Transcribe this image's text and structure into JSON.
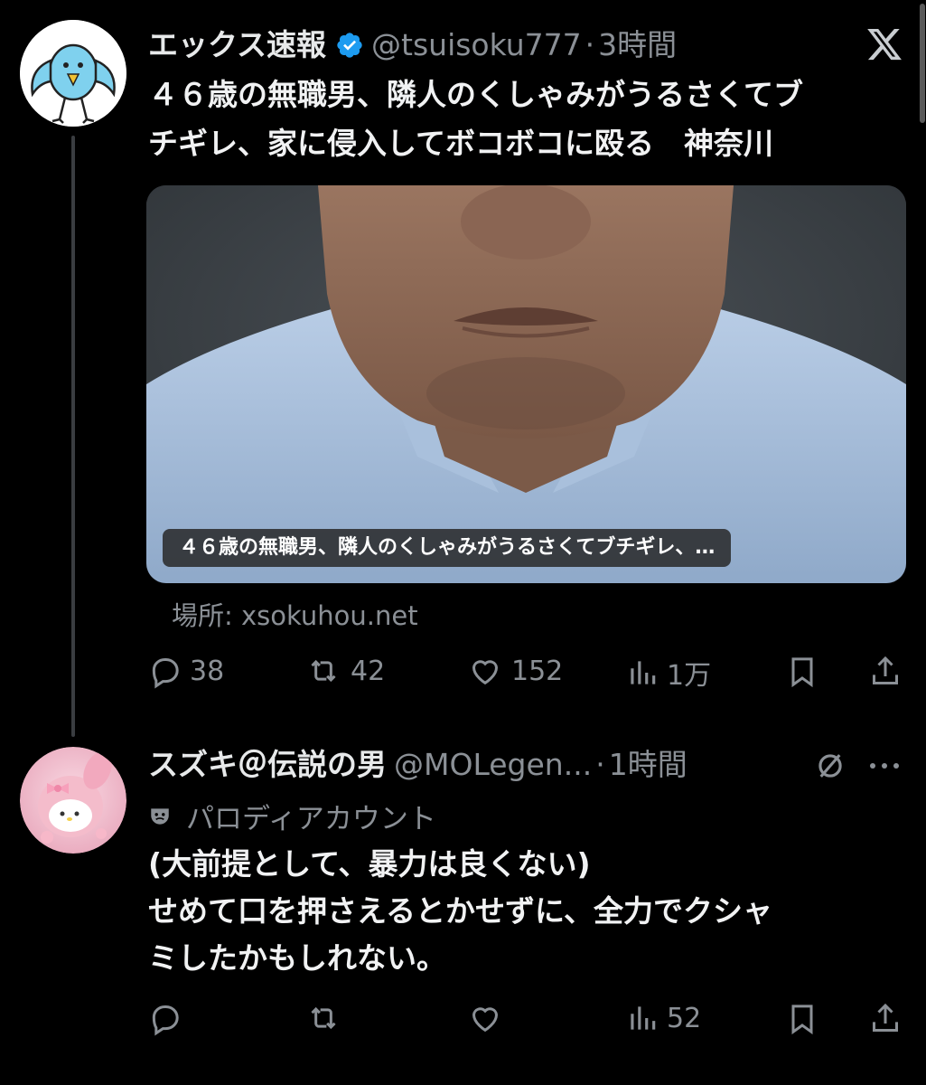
{
  "tweet": {
    "name": "エックス速報",
    "handle": "@tsuisoku777",
    "dot": "·",
    "time": "3時間",
    "text_line1": "４６歳の無職男、隣人のくしゃみがうるさくてブ",
    "text_line2": "チギレ、家に侵入してボコボコに殴る　神奈川",
    "card_caption": "４６歳の無職男、隣人のくしゃみがうるさくてブチギレ、…",
    "source": "場所: xsokuhou.net",
    "replies": "38",
    "reposts": "42",
    "likes": "152",
    "views": "1万"
  },
  "reply": {
    "name": "スズキ＠伝説の男",
    "handle": "@MOLegen...",
    "dot": "·",
    "time": "1時間",
    "parody_label": "パロディアカウント",
    "text_line1": "(大前提として、暴力は良くない)",
    "text_line2": "せめて口を押さえるとかせずに、全力でクシャ",
    "text_line3": "ミしたかもしれない。",
    "views": "52"
  },
  "colors": {
    "background": "#000000",
    "text": "#e7e9ea",
    "muted": "#8b9096",
    "verified": "#1d9bf0"
  },
  "icons": [
    "x-logo-icon",
    "verified-badge-icon",
    "reply-icon",
    "repost-icon",
    "like-icon",
    "views-icon",
    "bookmark-icon",
    "share-icon",
    "mute-icon",
    "more-icon",
    "parody-mask-icon"
  ]
}
